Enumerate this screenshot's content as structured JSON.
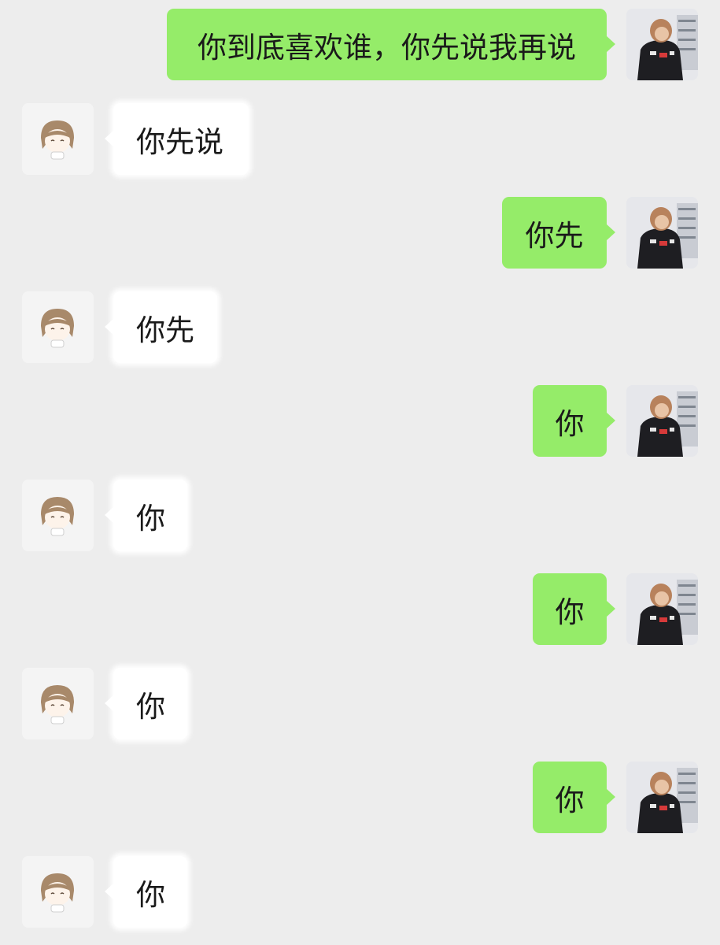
{
  "chat": {
    "messages": [
      {
        "side": "out",
        "text": "你到底喜欢谁，你先说我再说"
      },
      {
        "side": "in",
        "text": "你先说"
      },
      {
        "side": "out",
        "text": "你先"
      },
      {
        "side": "in",
        "text": "你先"
      },
      {
        "side": "out",
        "text": "你"
      },
      {
        "side": "in",
        "text": "你"
      },
      {
        "side": "out",
        "text": "你"
      },
      {
        "side": "in",
        "text": "你"
      },
      {
        "side": "out",
        "text": "你"
      },
      {
        "side": "in",
        "text": "你"
      }
    ]
  },
  "colors": {
    "background": "#ededed",
    "outgoing_bubble": "#95ec69",
    "incoming_bubble": "#ffffff",
    "text": "#1a1a1a"
  },
  "icons": {
    "self_avatar": "photo-avatar-dark-hoodie",
    "contact_avatar": "anime-girl-avatar"
  }
}
